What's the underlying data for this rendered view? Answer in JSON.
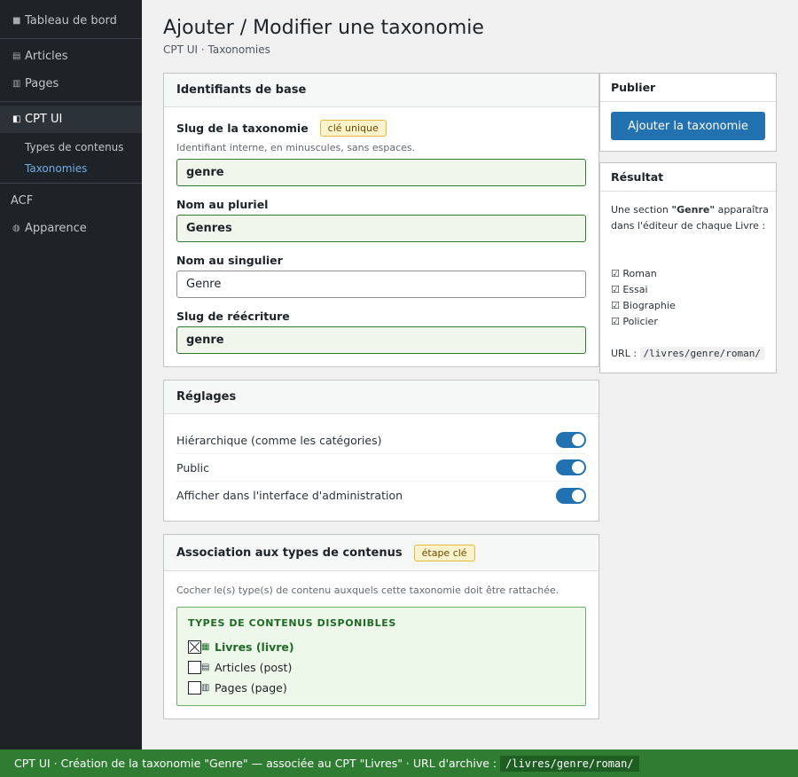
{
  "sidebar": {
    "items": [
      {
        "icon": "home-icon",
        "glyph": "■",
        "label": "Tableau de bord"
      },
      {
        "icon": "articles-icon",
        "glyph": "▤",
        "label": "Articles"
      },
      {
        "icon": "pages-icon",
        "glyph": "▥",
        "label": "Pages"
      },
      {
        "icon": "cptui-icon",
        "glyph": "◧",
        "label": "CPT UI"
      },
      {
        "icon": "",
        "glyph": "",
        "label": "ACF"
      },
      {
        "icon": "appearance-icon",
        "glyph": "◍",
        "label": "Apparence"
      }
    ],
    "subitems": [
      {
        "label": "Types de contenus"
      },
      {
        "label": "Taxonomies"
      }
    ]
  },
  "header": {
    "title": "Ajouter / Modifier une taxonomie",
    "breadcrumb": "CPT UI · Taxonomies"
  },
  "basics": {
    "title": "Identifiants de base",
    "slug_label": "Slug de la taxonomie",
    "slug_badge": "clé unique",
    "slug_hint": "Identifiant interne, en minuscules, sans espaces.",
    "slug_value": "genre",
    "plural_label": "Nom au pluriel",
    "plural_value": "Genres",
    "singular_label": "Nom au singulier",
    "singular_value": "Genre",
    "rewrite_label": "Slug de réécriture",
    "rewrite_value": "genre"
  },
  "settings": {
    "title": "Réglages",
    "toggles": [
      {
        "label": "Hiérarchique (comme les catégories)",
        "on": true
      },
      {
        "label": "Public",
        "on": true
      },
      {
        "label": "Afficher dans l'interface d'administration",
        "on": true
      }
    ]
  },
  "association": {
    "title": "Association aux types de contenus",
    "badge": "étape clé",
    "hint": "Cocher le(s) type(s) de contenu auxquels cette taxonomie doit être rattachée.",
    "box_title": "TYPES DE CONTENUS DISPONIBLES",
    "items": [
      {
        "label": "Livres (livre)",
        "checked": true,
        "icon": "book-icon",
        "glyph": "▦"
      },
      {
        "label": "Articles (post)",
        "checked": false,
        "icon": "post-icon",
        "glyph": "▤"
      },
      {
        "label": "Pages (page)",
        "checked": false,
        "icon": "page-icon",
        "glyph": "▥"
      }
    ]
  },
  "publish": {
    "title": "Publier",
    "button": "Ajouter la taxonomie"
  },
  "result": {
    "title": "Résultat",
    "intro_before": "Une section",
    "intro_name": "\"Genre\"",
    "intro_after": "apparaîtra dans l'éditeur de chaque Livre :",
    "terms": [
      "☑ Roman",
      "☑ Essai",
      "☑ Biographie",
      "☑ Policier"
    ],
    "url_label": "URL :",
    "url_value": "/livres/genre/roman/"
  },
  "footer": {
    "text": "CPT UI · Création de la taxonomie \"Genre\" — associée au CPT \"Livres\" · URL d'archive :",
    "url": "/livres/genre/roman/"
  },
  "colors": {
    "sidebar_bg": "#1d2327",
    "accent": "#2271b1",
    "success": "#2f7d32",
    "badge_bg": "#fcf2cc"
  }
}
